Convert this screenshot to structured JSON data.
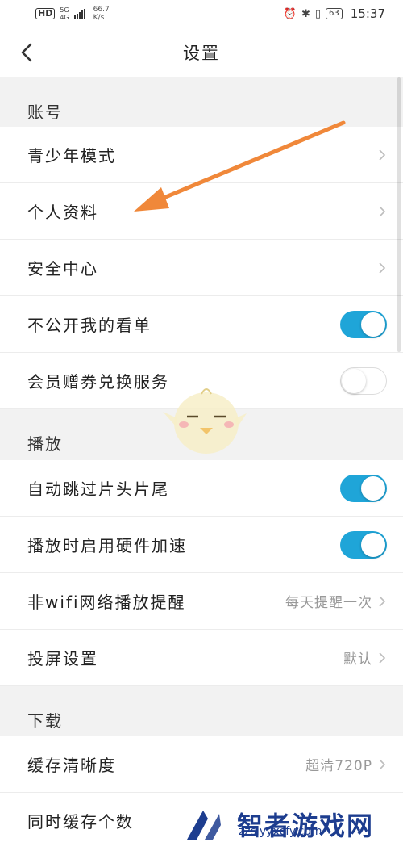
{
  "status_bar": {
    "hd": "HD",
    "network": "5G",
    "network_sub": "4G",
    "speed_value": "66.7",
    "speed_unit": "K/s",
    "battery": "63",
    "time": "15:37"
  },
  "nav": {
    "title": "设置"
  },
  "sections": [
    {
      "title": "账号",
      "rows": [
        {
          "label": "青少年模式",
          "type": "link"
        },
        {
          "label": "个人资料",
          "type": "link"
        },
        {
          "label": "安全中心",
          "type": "link"
        },
        {
          "label": "不公开我的看单",
          "type": "toggle",
          "on": true
        },
        {
          "label": "会员赠券兑换服务",
          "type": "toggle",
          "on": false
        }
      ]
    },
    {
      "title": "播放",
      "rows": [
        {
          "label": "自动跳过片头片尾",
          "type": "toggle",
          "on": true
        },
        {
          "label": "播放时启用硬件加速",
          "type": "toggle",
          "on": true
        },
        {
          "label": "非wifi网络播放提醒",
          "type": "link",
          "value": "每天提醒一次"
        },
        {
          "label": "投屏设置",
          "type": "link",
          "value": "默认"
        }
      ]
    },
    {
      "title": "下载",
      "rows": [
        {
          "label": "缓存清晰度",
          "type": "link",
          "value": "超清720P"
        },
        {
          "label": "同时缓存个数",
          "type": "link"
        }
      ]
    }
  ],
  "watermark": {
    "title": "智者游戏网",
    "url": "zzslyyxcfy.com"
  },
  "colors": {
    "toggle_on": "#1fa5d8",
    "annotation_arrow": "#f0883a",
    "watermark": "#1d3d8f"
  }
}
